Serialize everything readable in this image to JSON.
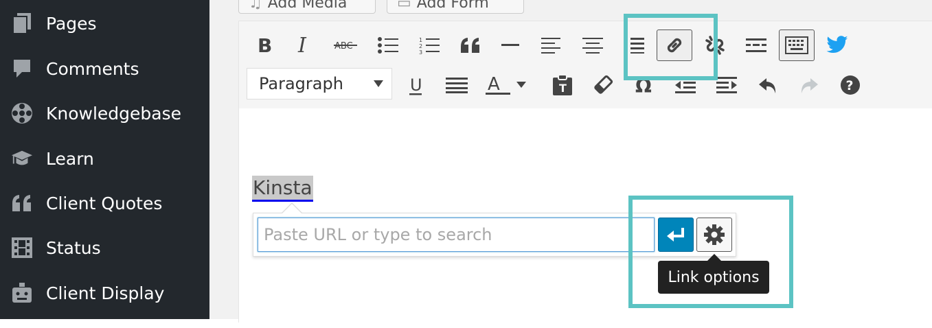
{
  "sidebar": {
    "items": [
      {
        "label": "Pages",
        "icon": "pages-icon"
      },
      {
        "label": "Comments",
        "icon": "comments-icon"
      },
      {
        "label": "Knowledgebase",
        "icon": "knowledgebase-icon"
      },
      {
        "label": "Learn",
        "icon": "learn-icon"
      },
      {
        "label": "Client Quotes",
        "icon": "quote-icon"
      },
      {
        "label": "Status",
        "icon": "status-icon"
      },
      {
        "label": "Client Display",
        "icon": "client-display-icon"
      }
    ]
  },
  "top_buttons": {
    "add_media": "Add Media",
    "add_form": "Add Form"
  },
  "editor": {
    "format_select": "Paragraph",
    "content_text": "Kinsta",
    "link_popup": {
      "placeholder": "Paste URL or type to search",
      "tooltip": "Link options"
    }
  },
  "colors": {
    "sidebar_bg": "#23282d",
    "accent_highlight": "#5cc3c3",
    "apply_button": "#0085ba",
    "twitter_blue": "#1da1f2"
  }
}
